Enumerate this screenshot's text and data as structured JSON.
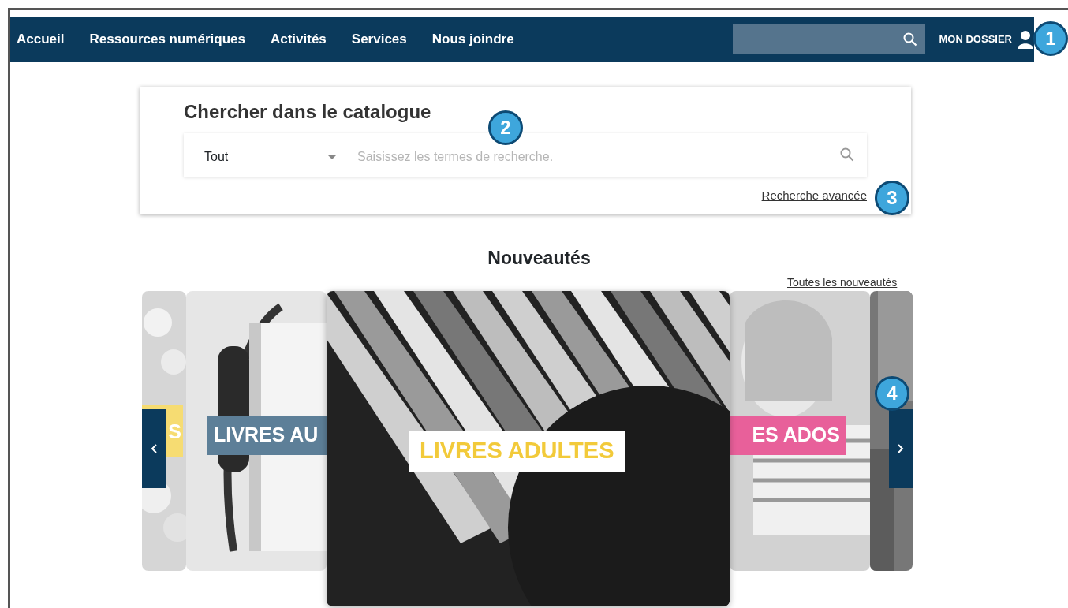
{
  "nav": {
    "items": [
      {
        "label": "Accueil"
      },
      {
        "label": "Ressources numériques"
      },
      {
        "label": "Activités"
      },
      {
        "label": "Services"
      },
      {
        "label": "Nous joindre"
      }
    ],
    "account": "MON DOSSIER"
  },
  "callouts": [
    "1",
    "2",
    "3",
    "4"
  ],
  "catalog": {
    "title": "Chercher dans le catalogue",
    "scope": "Tout",
    "placeholder": "Saisissez les termes de recherche.",
    "advanced_link": "Recherche avancée"
  },
  "news": {
    "title": "Nouveautés",
    "all_link": "Toutes les nouveautés",
    "slides": [
      {
        "label": "S",
        "color": "#f6dc72",
        "selected": false
      },
      {
        "label": "LIVRES AU",
        "color": "#5d7f98",
        "selected": false
      },
      {
        "label": "LIVRES ADULTES",
        "color": "#ffffff",
        "selected": true
      },
      {
        "label": "ES ADOS",
        "color": "#e8609a",
        "selected": false
      }
    ]
  }
}
